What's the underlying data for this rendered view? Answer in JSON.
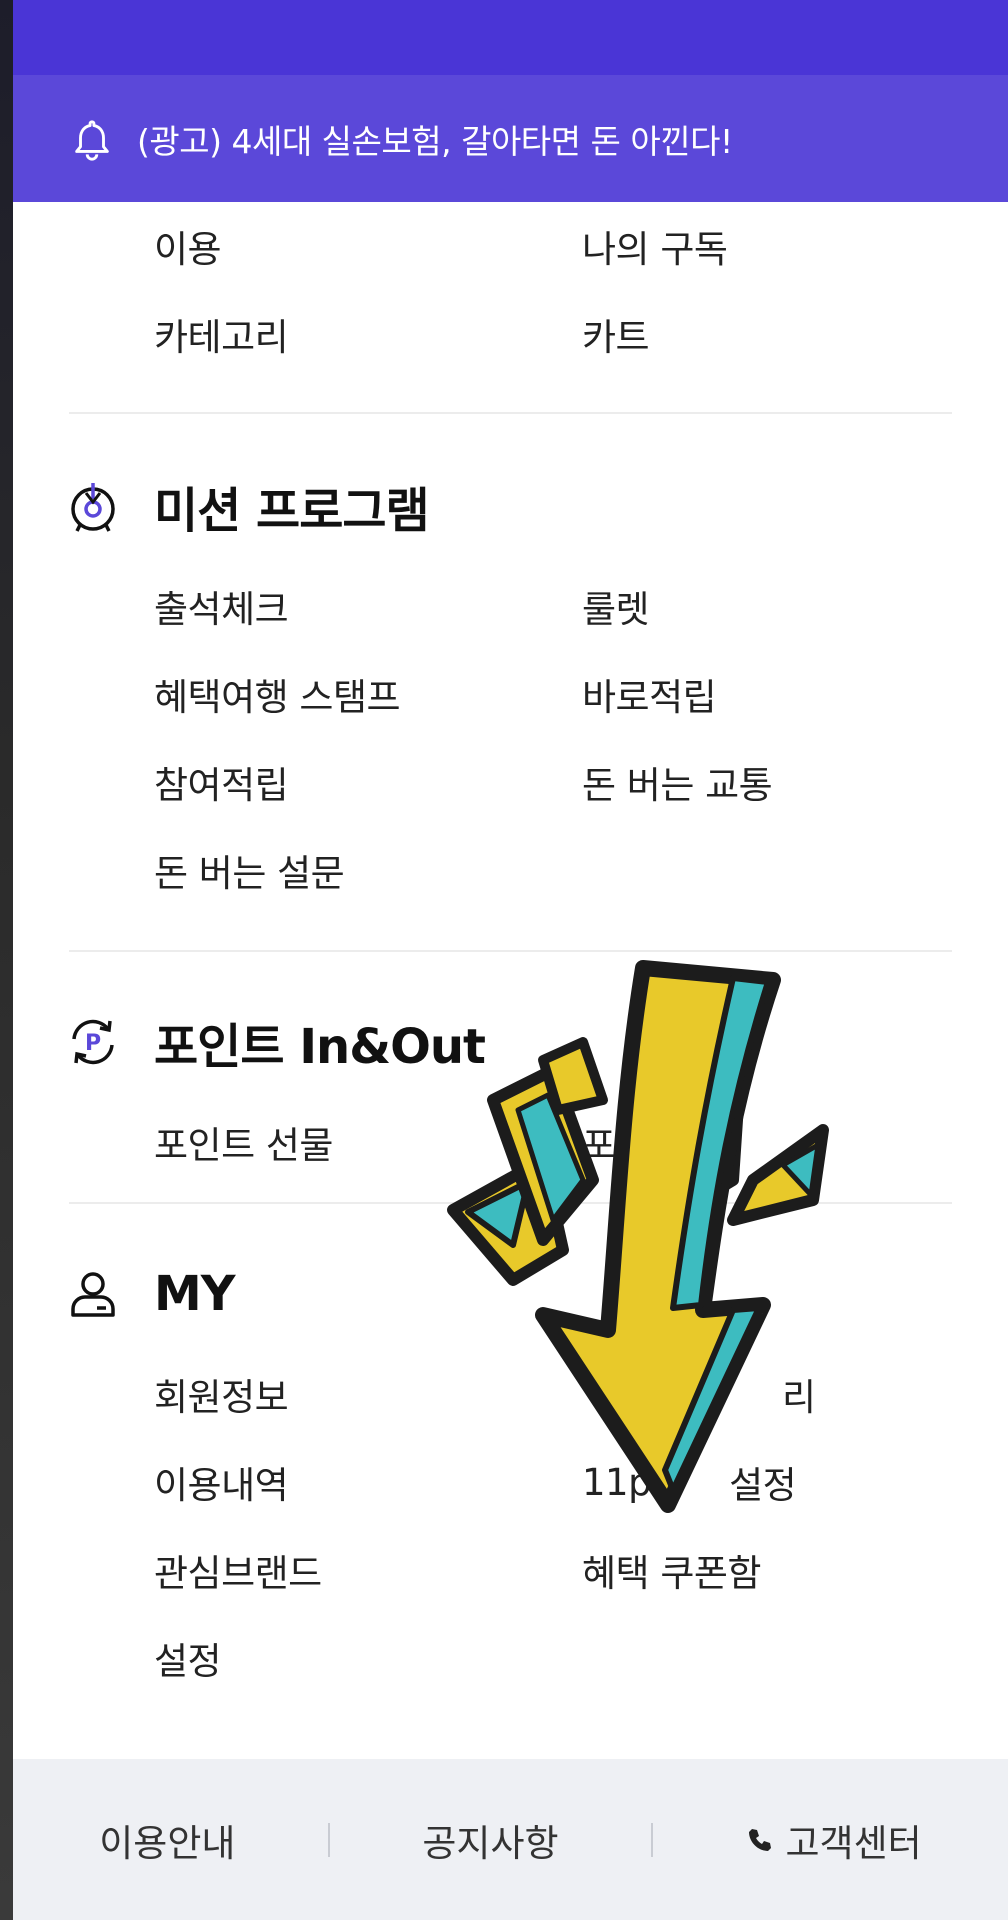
{
  "ad_banner": {
    "text": "(광고) 4세대 실손보험, 갈아타면 돈 아낀다!",
    "icon": "bell-icon"
  },
  "top_section": {
    "items": [
      "이용",
      "나의 구독",
      "카테고리",
      "카트"
    ]
  },
  "mission": {
    "title": "미션 프로그램",
    "icon": "medal-target-icon",
    "items": [
      "출석체크",
      "룰렛",
      "혜택여행 스탬프",
      "바로적립",
      "참여적립",
      "돈 버는 교통",
      "돈 버는 설문"
    ]
  },
  "points": {
    "title": "포인트 In&Out",
    "icon": "point-exchange-icon",
    "items": [
      "포인트 선물",
      "포"
    ]
  },
  "my": {
    "title": "MY",
    "icon": "user-icon",
    "items": [
      "회원정보",
      "리",
      "이용내역",
      "11p",
      "설정",
      "관심브랜드",
      "혜택 쿠폰함",
      "설정"
    ]
  },
  "footer": {
    "guide": "이용안내",
    "notice": "공지사항",
    "support": "고객센터"
  },
  "colors": {
    "primary": "#4a35d6",
    "banner": "#5b48d9",
    "footer_bg": "#eef0f4"
  }
}
